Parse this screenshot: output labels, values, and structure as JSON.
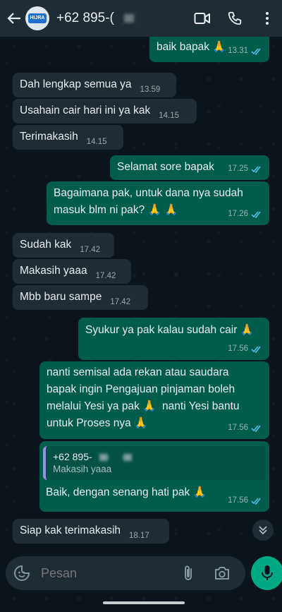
{
  "header": {
    "avatar_text": "HIJRA",
    "contact_name": "+62 895-("
  },
  "messages": [
    {
      "dir": "out",
      "text": "baik bapak 🙏",
      "time": "13.31"
    },
    {
      "dir": "in",
      "text": "Dah lengkap semua ya",
      "time": "13.59"
    },
    {
      "dir": "in",
      "text": "Usahain cair hari ini ya kak",
      "time": "14.15"
    },
    {
      "dir": "in",
      "text": "Terimakasih",
      "time": "14.15"
    },
    {
      "dir": "out",
      "text": "Selamat sore bapak",
      "time": "17.25"
    },
    {
      "dir": "out",
      "text": "Bagaimana pak, untuk dana nya sudah\nmasuk blm ni pak? 🙏 🙏",
      "time": "17.26"
    },
    {
      "dir": "in",
      "text": "Sudah kak",
      "time": "17.42"
    },
    {
      "dir": "in",
      "text": "Makasih yaaa",
      "time": "17.42"
    },
    {
      "dir": "in",
      "text": "Mbb baru sampe",
      "time": "17.42"
    },
    {
      "dir": "out",
      "text": "Syukur ya pak kalau sudah cair 🙏",
      "time": "17.56"
    },
    {
      "dir": "out",
      "text": "nanti semisal ada rekan atau saudara\nbapak ingin Pengajuan pinjaman boleh\nmelalui Yesi ya pak 🙏  nanti Yesi bantu\nuntuk Proses nya 🙏",
      "time": "17.56"
    },
    {
      "dir": "out",
      "quote_name": "+62 895-",
      "quote_text": "Makasih yaaa",
      "text": "Baik, dengan senang hati pak 🙏",
      "time": "17.56"
    },
    {
      "dir": "in",
      "text": "Siap kak terimakasih",
      "time": "18.17"
    }
  ],
  "composer": {
    "placeholder": "Pesan"
  },
  "colors": {
    "background": "#0b141a",
    "incoming_bubble": "#1f2c33",
    "outgoing_bubble": "#005c4b",
    "read_ticks": "#53bdeb",
    "accent": "#00a884"
  },
  "icons": [
    "back-arrow-icon",
    "video-call-icon",
    "phone-icon",
    "more-vert-icon",
    "double-chevron-down-icon",
    "emoji-icon",
    "attach-icon",
    "camera-icon",
    "mic-icon"
  ]
}
